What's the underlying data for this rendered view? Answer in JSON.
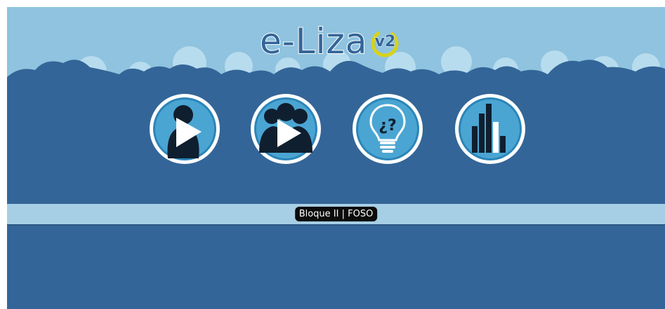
{
  "app": {
    "logo_text": "e-Liza",
    "logo_badge": "v2",
    "brand_colors": {
      "sky": "#8fc3df",
      "background": "#336598",
      "band": "#a6cfe6",
      "badge_ring": "#d8d21a"
    }
  },
  "menu": {
    "buttons": [
      {
        "icon": "play-single-user-icon"
      },
      {
        "icon": "play-group-icon"
      },
      {
        "icon": "help-lightbulb-icon"
      },
      {
        "icon": "statistics-chart-icon"
      }
    ]
  },
  "status": {
    "label": "Bloque II | FOSO"
  }
}
